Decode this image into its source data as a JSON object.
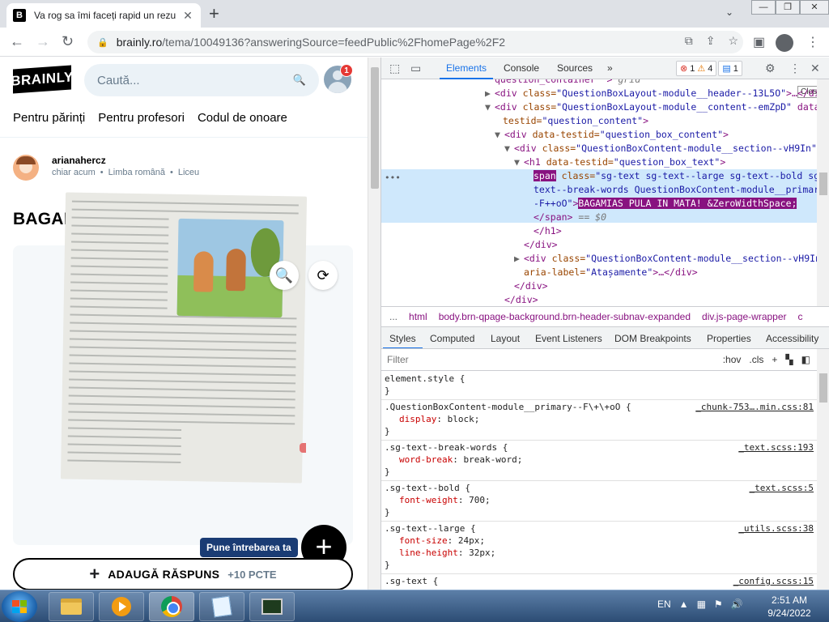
{
  "browser": {
    "tab_title": "Va rog sa îmi faceți rapid un rezu",
    "tab_favicon_letter": "B",
    "url_host": "brainly.ro",
    "url_path": "/tema/10049136?answeringSource=feedPublic%2FhomePage%2F2",
    "icons": [
      "back-icon",
      "forward-icon",
      "reload-icon",
      "lock-icon",
      "translate-icon",
      "share-icon",
      "star-icon",
      "sidepanel-icon",
      "profile-icon",
      "menu-icon"
    ]
  },
  "brainly": {
    "logo": "BRAINLY",
    "search_placeholder": "Caută...",
    "notification_count": "1",
    "subnav": [
      "Pentru părinți",
      "Pentru profesori",
      "Codul de onoare"
    ],
    "question": {
      "username": "arianahercz",
      "time": "chiar acum",
      "subject": "Limba română",
      "level": "Liceu",
      "title": "BAGAMIAS PULA IN MATA!"
    },
    "ask_label": "Pune întrebarea ta",
    "answer_label": "ADAUGĂ RĂSPUNS",
    "answer_points": "+10 PCTE"
  },
  "devtools": {
    "tabs": [
      "Elements",
      "Console",
      "Sources",
      "»"
    ],
    "active_tab": "Elements",
    "errors": "1",
    "warnings": "4",
    "messages": "1",
    "tooltip": "Close",
    "dom_lines": [
      {
        "indent": 10,
        "tri": "",
        "html": "question_container\" > <span class='eq'>grid</span>"
      },
      {
        "indent": 10,
        "tri": "▶",
        "tag": "<div ",
        "attr": "class=",
        "val": "\"QuestionBoxLayout-module__header--13L5O\"",
        "rest": ">…</div>"
      },
      {
        "indent": 10,
        "tri": "▼",
        "tag": "<div ",
        "attr": "class=",
        "val": "\"QuestionBoxLayout-module__content--emZpD\"",
        "rest": " data-"
      },
      {
        "indent": 20,
        "tri": "",
        "attr": "testid=",
        "val": "\"question_content\"",
        "rest": ">"
      },
      {
        "indent": 22,
        "tri": "▼",
        "tag": "<div ",
        "attr": "data-testid=",
        "val": "\"question_box_content\"",
        "rest": ">"
      },
      {
        "indent": 34,
        "tri": "▼",
        "tag": "<div ",
        "attr": "class=",
        "val": "\"QuestionBoxContent-module__section--vH9In\"",
        "rest": ">"
      },
      {
        "indent": 46,
        "tri": "▼",
        "tag": "<h1 ",
        "attr": "data-testid=",
        "val": "\"question_box_text\"",
        "rest": ">"
      }
    ],
    "selected": {
      "line1_attr": "class=",
      "line1_val": "\"sg-text sg-text--large sg-text--bold sg-",
      "line2": "text--break-words QuestionBoxContent-module__primary-",
      "line3_val": "-F++oO\"",
      "text": "BAGAMIAS PULA IN MATA! &ZeroWidthSpace;",
      "close": "</span>",
      "eq": "== $0"
    },
    "dom_after": [
      {
        "indent": 58,
        "text": "</h1>"
      },
      {
        "indent": 46,
        "text": "</div>"
      },
      {
        "indent": 46,
        "tri": "▶",
        "tag": "<div ",
        "attr": "class=",
        "val": "\"QuestionBoxContent-module__section--vH9In\""
      },
      {
        "indent": 46,
        "attr": "aria-label=",
        "val": "\"Atașamente\"",
        "rest": ">…</div>"
      },
      {
        "indent": 34,
        "text": "</div>"
      },
      {
        "indent": 22,
        "text": "</div>"
      }
    ],
    "breadcrumbs": [
      "...",
      "html",
      "body.brn-qpage-background.brn-header-subnav-expanded",
      "div.js-page-wrapper",
      "c"
    ],
    "sub_tabs": [
      "Styles",
      "Computed",
      "Layout",
      "Event Listeners",
      "DOM Breakpoints",
      "Properties",
      "Accessibility"
    ],
    "filter_placeholder": "Filter",
    "filter_tools": [
      ":hov",
      ".cls",
      "+"
    ],
    "rules": [
      {
        "selector": "element.style {",
        "source": "",
        "props": []
      },
      {
        "selector": ".QuestionBoxContent-module__primary--F\\+\\+oO {",
        "source": "_chunk-753….min.css:81",
        "props": [
          {
            "name": "display",
            "value": "block;"
          }
        ]
      },
      {
        "selector": ".sg-text--break-words {",
        "source": "_text.scss:193",
        "props": [
          {
            "name": "word-break",
            "value": "break-word;"
          }
        ]
      },
      {
        "selector": ".sg-text--bold {",
        "source": "_text.scss:5",
        "props": [
          {
            "name": "font-weight",
            "value": "700;"
          }
        ]
      },
      {
        "selector": ".sg-text--large {",
        "source": "_utils.scss:38",
        "props": [
          {
            "name": "font-size",
            "value": "24px;"
          },
          {
            "name": "line-height",
            "value": "32px;"
          }
        ]
      },
      {
        "selector": ".sg-text {",
        "source": "_config.scss:15",
        "props": []
      }
    ]
  },
  "taskbar": {
    "language": "EN",
    "time": "2:51 AM",
    "date": "9/24/2022"
  }
}
